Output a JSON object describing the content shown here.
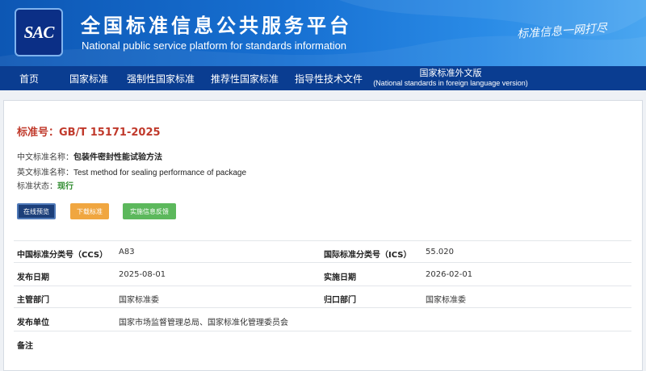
{
  "header": {
    "logo_text": "SAC",
    "title": "全国标准信息公共服务平台",
    "subtitle": "National public service platform  for standards information",
    "slogan": "标准信息一网打尽"
  },
  "nav": {
    "items": [
      {
        "label": "首页"
      },
      {
        "label": "国家标准"
      },
      {
        "label": "强制性国家标准"
      },
      {
        "label": "推荐性国家标准"
      },
      {
        "label": "指导性技术文件"
      }
    ],
    "foreign": {
      "label": "国家标准外文版",
      "sublabel": "(National standards in foreign language version)"
    }
  },
  "standard": {
    "number_label": "标准号：",
    "number": "GB/T 15171-2025",
    "cn_name_label": "中文标准名称：",
    "cn_name": "包装件密封性能试验方法",
    "en_name_label": "英文标准名称：",
    "en_name": "Test method for sealing performance of package",
    "status_label": "标准状态：",
    "status": "现行"
  },
  "buttons": {
    "preview": "在线预览",
    "download": "下载标准",
    "feedback": "实施信息反馈"
  },
  "details": {
    "ccs_label": "中国标准分类号（CCS）",
    "ccs_value": "A83",
    "ics_label": "国际标准分类号（ICS）",
    "ics_value": "55.020",
    "publish_label": "发布日期",
    "publish_value": "2025-08-01",
    "implement_label": "实施日期",
    "implement_value": "2026-02-01",
    "dept_label": "主管部门",
    "dept_value": "国家标准委",
    "belong_label": "归口部门",
    "belong_value": "国家标准委",
    "issuer_label": "发布单位",
    "issuer_value": "国家市场监督管理总局、国家标准化管理委员会",
    "remark_label": "备注"
  }
}
